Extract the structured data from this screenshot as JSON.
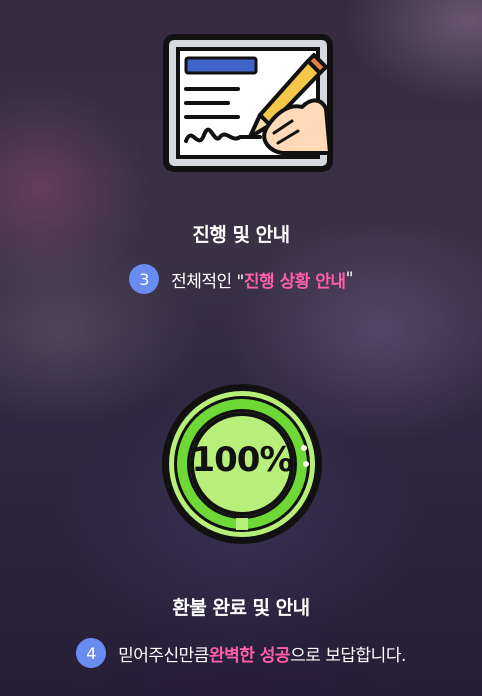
{
  "steps": [
    {
      "icon": "contract-signing-icon",
      "title": "진행 및 안내",
      "number": "3",
      "desc_pre": "전체적인 \"",
      "desc_highlight": "진행 상황 안내",
      "desc_post": "\""
    },
    {
      "icon": "progress-100-percent-icon",
      "title": "환불 완료 및 안내",
      "number": "4",
      "desc_pre": "믿어주신만큼 ",
      "desc_highlight": "완벽한 성공",
      "desc_post": "으로 보답합니다.",
      "progress_text": "100%",
      "progress": 1.0
    }
  ],
  "colors": {
    "accent_pink": "#ff5fa8",
    "badge_blue": "#6a8cf0",
    "progress_green": "#6dd836",
    "progress_light": "#b8ef7a"
  }
}
